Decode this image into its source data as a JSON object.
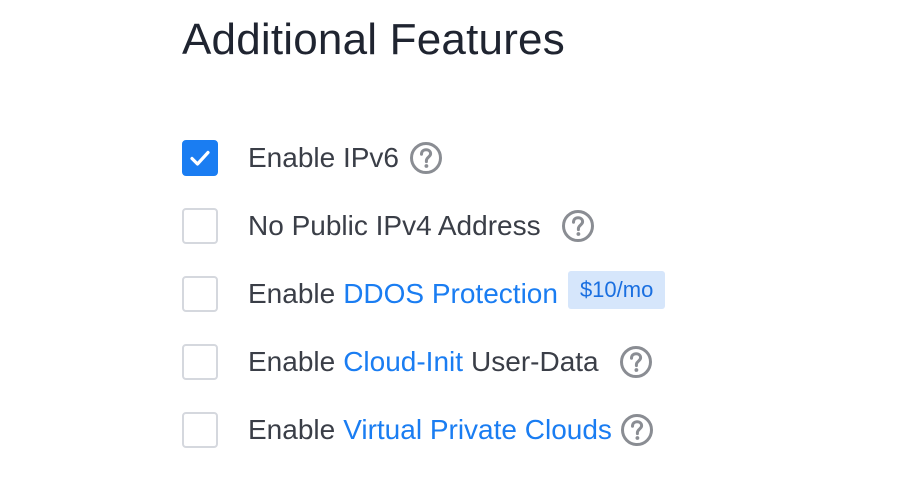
{
  "section": {
    "title": "Additional Features"
  },
  "features": [
    {
      "prefix": "Enable IPv6",
      "checked": true
    },
    {
      "prefix": "No Public IPv4 Address",
      "checked": false
    },
    {
      "prefix": "Enable",
      "link": "DDOS Protection",
      "badge": "$10/mo",
      "checked": false
    },
    {
      "prefix": "Enable",
      "link": "Cloud-Init",
      "suffix": "User-Data",
      "checked": false
    },
    {
      "prefix": "Enable",
      "link": "Virtual Private Clouds",
      "checked": false
    }
  ],
  "icons": {
    "help": "question-circle-icon",
    "check": "checkmark-icon"
  },
  "colors": {
    "accent": "#1a7df2",
    "badge_bg": "#d6e6fb",
    "help_icon": "#8a8d93",
    "checkbox_border": "#d5d8de"
  }
}
